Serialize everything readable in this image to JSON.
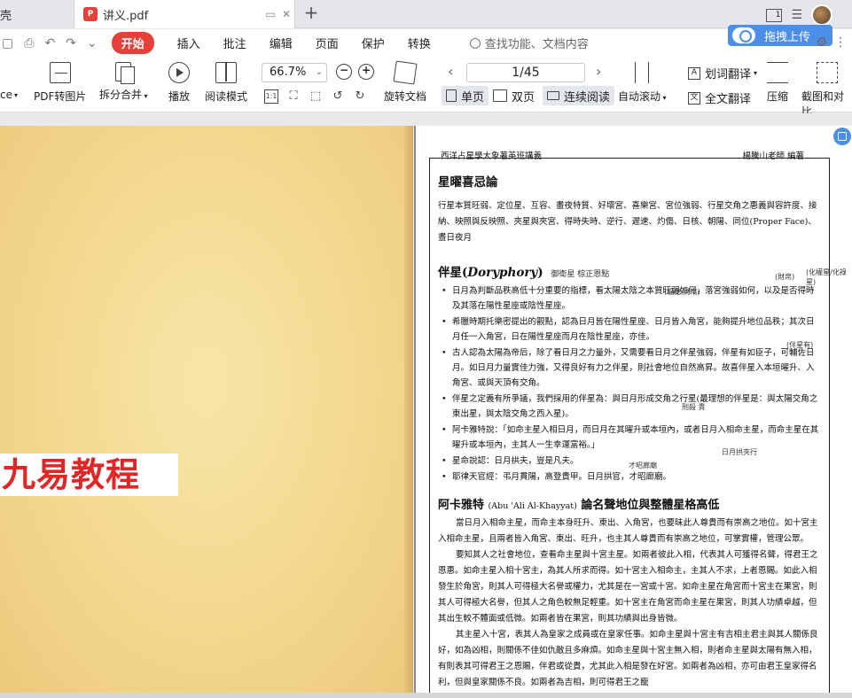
{
  "tabs": {
    "prev_label": "壳",
    "active_label": "讲义.pdf"
  },
  "window": {
    "badge": "1"
  },
  "menu": {
    "items": [
      "开始",
      "插入",
      "批注",
      "编辑",
      "页面",
      "保护",
      "转换"
    ],
    "search_placeholder": "查找功能、文档内容",
    "upload_label": "拖拽上传"
  },
  "toolbar": {
    "partial_left": "ce",
    "pdf_to_image": "PDF转图片",
    "split_merge": "拆分合并",
    "play": "播放",
    "read_mode": "阅读模式",
    "zoom": "66.7%",
    "rotate_doc": "旋转文档",
    "page": "1/45",
    "single_page": "单页",
    "double_page": "双页",
    "continuous": "连续阅读",
    "auto_scroll": "自动滚动",
    "word_translate": "划词翻译",
    "full_translate": "全文翻译",
    "compress": "压缩",
    "screenshot_compare": "截图和对比"
  },
  "document": {
    "watermark": "九易教程",
    "header_left": "西洋占星學大象著英班講義",
    "header_right": "楊騰山老師 編著",
    "title1": "星曜喜忌論",
    "para1": "行星本質旺弱、定位星、互容、畫夜特質、好壞宮、喜樂宮、宮位強弱、行星交角之惠義與容許度、接納、映照與反映照、夾星與夾宮、得時失時、逆行、遲速、灼傷、日核、朝陽、同位(Proper Face)、晝日夜月",
    "title2_cn": "伴星(",
    "title2_en": "Doryphory",
    "title2_end": ")",
    "title2_note": "御衛星 棕正恩點",
    "bullets": [
      "日月為判斷品秩高低十分重要的指標，看太陽太陰之本質旺弱如何，落宮強弱如何，以及是否得時及其落在陽性星座或陰性星座。",
      "希臘時期托樂密提出的觀點，認為日月皆在陽性星座、日月皆入角宮，能夠提升地位品秩；其次日月任一入角宮，日在陽性星座而月在陰性星座，亦佳。",
      "古人認為太陽為帝后，除了看日月之力量外，又需要看日月之伴星強弱，伴星有如臣子，可輔佐日月。如日月力量實佳力強，又得良好有力之伴星，則社會地位自然高昇。故喜伴星入本垣曜升、入角宮、或與天頂有交角。",
      "伴星之定義有所爭議，我們採用的伴星為：與日月形成交角之行星(最理想的伴星是：與太陽交角之東出星，與太陰交角之西入星)。",
      "阿卡雅特說：「如命主星入相日月，而日月在其曜升或本垣內，或者日月入相命主星，而命主星在其曜升或本垣內，主其人一生幸運富裕。」",
      "星命說認：日月拱夫，豈是凡夫。",
      "耶律天官經：弔月貫陽，高登貴甲。日月拱官，才昭廊廟。"
    ],
    "title3": "阿卡雅特",
    "title3_sub": "(Abu 'Ali Al-Khayyat)",
    "title3_end": "論名聲地位與整體星格高低",
    "para3": [
      "當日月入相命主星，而命主本身旺升、東出、入角宮，也要昧此人尊貴而有崇高之地位。如十宮主入相命主星，且兩者皆入角宮、東出、旺升，也主其人尊貴而有崇高之地位，可掌實權，管理公眾。",
      "要知其人之社會地位，查看命主星與十宮主星。如兩者彼此入相，代表其人可獲得名聲，得君王之恩惠。如命主星入相十宮主，為其人所求而得。如十宮主入相命主，主其人不求，上者恩賜。如此入相發生於角宮，則其人可得極大名譽或權力，尤其是在一宮或十宮。如命主星在角宮而十宮主在果宮，則其人可得極大名譽，但其人之角色較無足輕重。如十宮主在角宮而命主星在果宮，則其人功績卓越，但其出生較不體面或低微。如兩者皆在果宮，則其功績與出身皆微。",
      "其主星入十宮，表其人為皇家之成員或在皇家任事。如命主星與十宮主有吉相主君主與其人關係良好，如為凶相，則關係不佳如仇敵且多麻煩。如命主星與十宮主無入相，則者命主星與太陽有無入相，有則表其可得君王之恩賜，伴君或從貴，尤其此入相是發在好宮。如兩者為凶相，亦可由君王皇家得名利，但與皇家關係不良。如兩者為吉相，則可得君王之寵"
    ],
    "hand_notes": [
      "(財帛)",
      "(化權星/化祿星)",
      "(福德,財帛)",
      "(伴星有)",
      "刑殺 貴",
      "日月拱夾行",
      "才昭廊廟"
    ]
  }
}
